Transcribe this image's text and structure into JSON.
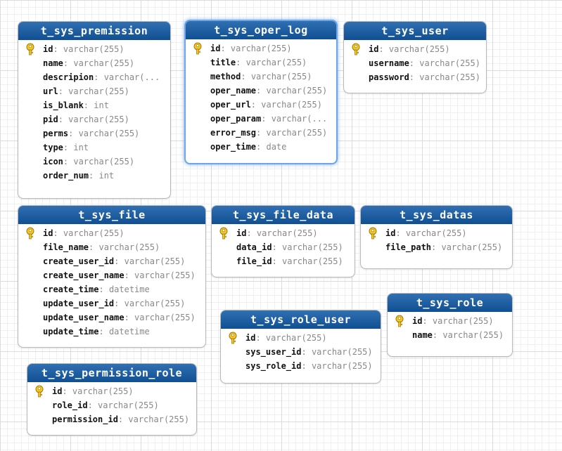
{
  "canvas": {
    "grid": true
  },
  "icons": {
    "primary_key": "key-icon"
  },
  "colors": {
    "header_top": "#2f6fb2",
    "header_bottom": "#0f4f92",
    "selected_border": "#6aa6e8",
    "key": "#e8b820"
  },
  "entities": [
    {
      "id": "t_sys_premission",
      "name": "t_sys_premission",
      "selected": false,
      "fields": [
        {
          "name": "id",
          "type": "varchar(255)",
          "pk": true
        },
        {
          "name": "name",
          "type": "varchar(255)"
        },
        {
          "name": "descripion",
          "type": "varchar(..."
        },
        {
          "name": "url",
          "type": "varchar(255)"
        },
        {
          "name": "is_blank",
          "type": "int"
        },
        {
          "name": "pid",
          "type": "varchar(255)"
        },
        {
          "name": "perms",
          "type": "varchar(255)"
        },
        {
          "name": "type",
          "type": "int"
        },
        {
          "name": "icon",
          "type": "varchar(255)"
        },
        {
          "name": "order_num",
          "type": "int"
        }
      ]
    },
    {
      "id": "t_sys_oper_log",
      "name": "t_sys_oper_log",
      "selected": true,
      "fields": [
        {
          "name": "id",
          "type": "varchar(255)",
          "pk": true
        },
        {
          "name": "title",
          "type": "varchar(255)"
        },
        {
          "name": "method",
          "type": "varchar(255)"
        },
        {
          "name": "oper_name",
          "type": "varchar(255)"
        },
        {
          "name": "oper_url",
          "type": "varchar(255)"
        },
        {
          "name": "oper_param",
          "type": "varchar(..."
        },
        {
          "name": "error_msg",
          "type": "varchar(255)"
        },
        {
          "name": "oper_time",
          "type": "date"
        }
      ]
    },
    {
      "id": "t_sys_user",
      "name": "t_sys_user",
      "selected": false,
      "fields": [
        {
          "name": "id",
          "type": "varchar(255)",
          "pk": true
        },
        {
          "name": "username",
          "type": "varchar(255)"
        },
        {
          "name": "password",
          "type": "varchar(255)"
        }
      ]
    },
    {
      "id": "t_sys_file",
      "name": "t_sys_file",
      "selected": false,
      "fields": [
        {
          "name": "id",
          "type": "varchar(255)",
          "pk": true
        },
        {
          "name": "file_name",
          "type": "varchar(255)"
        },
        {
          "name": "create_user_id",
          "type": "varchar(255)"
        },
        {
          "name": "create_user_name",
          "type": "varchar(255)"
        },
        {
          "name": "create_time",
          "type": "datetime"
        },
        {
          "name": "update_user_id",
          "type": "varchar(255)"
        },
        {
          "name": "update_user_name",
          "type": "varchar(255)"
        },
        {
          "name": "update_time",
          "type": "datetime"
        }
      ]
    },
    {
      "id": "t_sys_file_data",
      "name": "t_sys_file_data",
      "selected": false,
      "fields": [
        {
          "name": "id",
          "type": "varchar(255)",
          "pk": true
        },
        {
          "name": "data_id",
          "type": "varchar(255)"
        },
        {
          "name": "file_id",
          "type": "varchar(255)"
        }
      ]
    },
    {
      "id": "t_sys_datas",
      "name": "t_sys_datas",
      "selected": false,
      "fields": [
        {
          "name": "id",
          "type": "varchar(255)",
          "pk": true
        },
        {
          "name": "file_path",
          "type": "varchar(255)"
        }
      ]
    },
    {
      "id": "t_sys_role",
      "name": "t_sys_role",
      "selected": false,
      "fields": [
        {
          "name": "id",
          "type": "varchar(255)",
          "pk": true
        },
        {
          "name": "name",
          "type": "varchar(255)"
        }
      ]
    },
    {
      "id": "t_sys_role_user",
      "name": "t_sys_role_user",
      "selected": false,
      "fields": [
        {
          "name": "id",
          "type": "varchar(255)",
          "pk": true
        },
        {
          "name": "sys_user_id",
          "type": "varchar(255)"
        },
        {
          "name": "sys_role_id",
          "type": "varchar(255)"
        }
      ]
    },
    {
      "id": "t_sys_permission_role",
      "name": "t_sys_permission_role",
      "selected": false,
      "fields": [
        {
          "name": "id",
          "type": "varchar(255)",
          "pk": true
        },
        {
          "name": "role_id",
          "type": "varchar(255)"
        },
        {
          "name": "permission_id",
          "type": "varchar(255)"
        }
      ]
    }
  ]
}
